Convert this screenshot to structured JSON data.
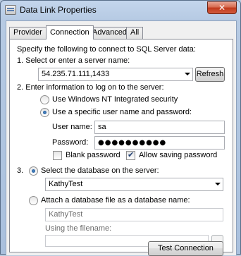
{
  "window": {
    "title": "Data Link Properties",
    "close_glyph": "✕"
  },
  "tabs": [
    "Provider",
    "Connection",
    "Advanced",
    "All"
  ],
  "active_tab": "Connection",
  "connection": {
    "intro": "Specify the following to connect to SQL Server data:",
    "step1_label": "1. Select or enter a server name:",
    "server_value": "54.235.71.111,1433",
    "refresh_label": "Refresh",
    "step2_label": "2. Enter information to log on to the server:",
    "radio_nt_label": "Use Windows NT Integrated security",
    "radio_specific_label": "Use a specific user name and password:",
    "username_label": "User name:",
    "username_value": "sa",
    "password_label": "Password:",
    "password_mask": "●●●●●●●●●●",
    "blank_password_label": "Blank password",
    "allow_saving_label": "Allow saving password",
    "step3_label": "3.",
    "radio_select_db_label": "Select the database on the server:",
    "database_value": "KathyTest",
    "radio_attach_label": "Attach a database file as a database name:",
    "attach_name_value": "KathyTest",
    "using_filename_label": "Using the filename:",
    "browse_label": "...",
    "test_connection_label": "Test Connection"
  }
}
